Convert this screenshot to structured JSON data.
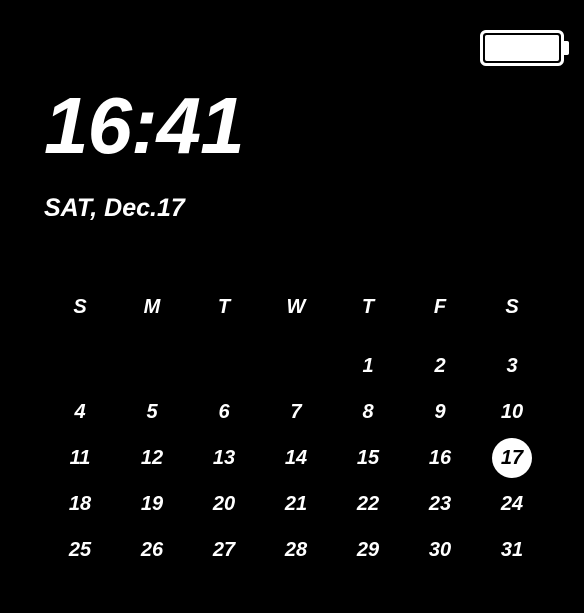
{
  "status": {
    "battery_percent": 100
  },
  "clock": {
    "time": "16:41",
    "date": "SAT, Dec.17"
  },
  "calendar": {
    "dow": [
      "S",
      "M",
      "T",
      "W",
      "T",
      "F",
      "S"
    ],
    "leading_blanks": 4,
    "days_in_month": 31,
    "today": 17
  }
}
